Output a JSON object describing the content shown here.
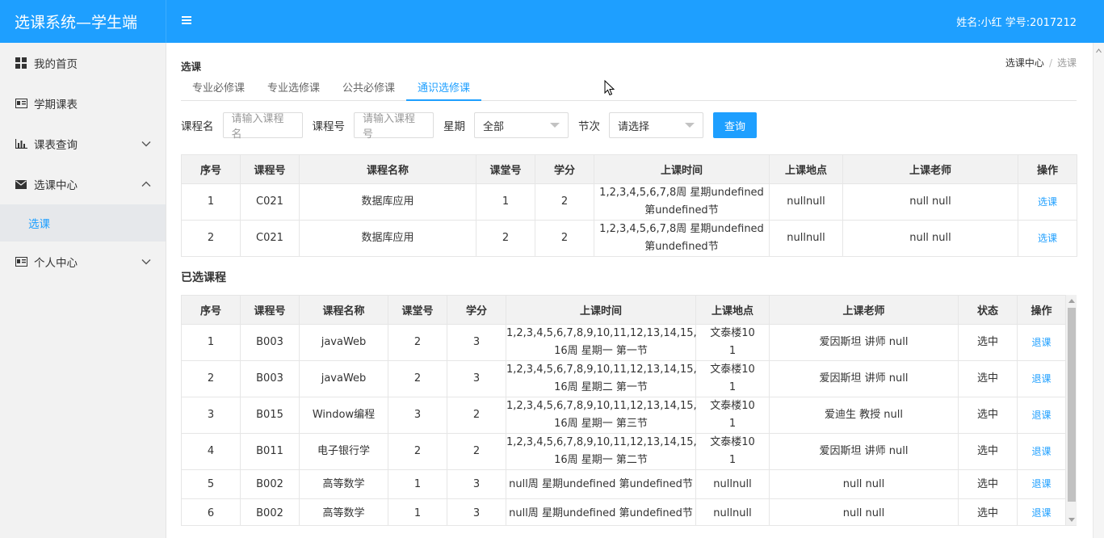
{
  "header": {
    "title": "选课系统—学生端",
    "user_info": "姓名:小红 学号:2017212"
  },
  "sidebar": {
    "items": [
      {
        "label": "我的首页",
        "icon": "grid-icon"
      },
      {
        "label": "学期课表",
        "icon": "id-card-icon"
      },
      {
        "label": "课表查询",
        "icon": "bar-chart-icon",
        "expandable": true
      },
      {
        "label": "选课中心",
        "icon": "envelope-icon",
        "expanded": true
      },
      {
        "label": "个人中心",
        "icon": "id-card-icon",
        "expandable": true
      }
    ],
    "sub_item": "选课"
  },
  "page": {
    "title": "选课",
    "breadcrumb": [
      "选课中心",
      "/",
      "选课"
    ]
  },
  "tabs": [
    {
      "label": "专业必修课",
      "active": false
    },
    {
      "label": "专业选修课",
      "active": false
    },
    {
      "label": "公共必修课",
      "active": false
    },
    {
      "label": "通识选修课",
      "active": true
    }
  ],
  "filters": {
    "course_name_label": "课程名",
    "course_name_placeholder": "请输入课程名",
    "course_no_label": "课程号",
    "course_no_placeholder": "请输入课程号",
    "weekday_label": "星期",
    "weekday_value": "全部",
    "period_label": "节次",
    "period_value": "请选择",
    "query_button": "查询"
  },
  "available_table": {
    "headers": [
      "序号",
      "课程号",
      "课程名称",
      "课堂号",
      "学分",
      "上课时间",
      "上课地点",
      "上课老师",
      "操作"
    ],
    "rows": [
      {
        "no": "1",
        "code": "C021",
        "name": "数据库应用",
        "class": "1",
        "credit": "2",
        "time1": "1,2,3,4,5,6,7,8周 星期undefined",
        "time2": "第undefined节",
        "place": "nullnull",
        "teacher": "null null",
        "action": "选课"
      },
      {
        "no": "2",
        "code": "C021",
        "name": "数据库应用",
        "class": "2",
        "credit": "2",
        "time1": "1,2,3,4,5,6,7,8周 星期undefined",
        "time2": "第undefined节",
        "place": "nullnull",
        "teacher": "null null",
        "action": "选课"
      }
    ]
  },
  "selected": {
    "title": "已选课程",
    "headers": [
      "序号",
      "课程号",
      "课程名称",
      "课堂号",
      "学分",
      "上课时间",
      "上课地点",
      "上课老师",
      "状态",
      "操作"
    ],
    "rows": [
      {
        "no": "1",
        "code": "B003",
        "name": "javaWeb",
        "class": "2",
        "credit": "3",
        "time1": "1,2,3,4,5,6,7,8,9,10,11,12,13,14,15,",
        "time2": "16周 星期一 第一节",
        "place1": "文泰楼10",
        "place2": "1",
        "teacher": "爱因斯坦 讲师 null",
        "status": "选中",
        "action": "退课"
      },
      {
        "no": "2",
        "code": "B003",
        "name": "javaWeb",
        "class": "2",
        "credit": "3",
        "time1": "1,2,3,4,5,6,7,8,9,10,11,12,13,14,15,",
        "time2": "16周 星期二 第一节",
        "place1": "文泰楼10",
        "place2": "1",
        "teacher": "爱因斯坦 讲师 null",
        "status": "选中",
        "action": "退课"
      },
      {
        "no": "3",
        "code": "B015",
        "name": "Window编程",
        "class": "3",
        "credit": "2",
        "time1": "1,2,3,4,5,6,7,8,9,10,11,12,13,14,15,",
        "time2": "16周 星期一 第三节",
        "place1": "文泰楼10",
        "place2": "1",
        "teacher": "爱迪生 教授 null",
        "status": "选中",
        "action": "退课"
      },
      {
        "no": "4",
        "code": "B011",
        "name": "电子银行学",
        "class": "2",
        "credit": "2",
        "time1": "1,2,3,4,5,6,7,8,9,10,11,12,13,14,15,",
        "time2": "16周 星期一 第二节",
        "place1": "文泰楼10",
        "place2": "1",
        "teacher": "爱因斯坦 讲师 null",
        "status": "选中",
        "action": "退课"
      },
      {
        "no": "5",
        "code": "B002",
        "name": "高等数学",
        "class": "1",
        "credit": "3",
        "time1": "null周 星期undefined 第undefined节",
        "time2": "",
        "place1": "nullnull",
        "place2": "",
        "teacher": "null null",
        "status": "选中",
        "action": "退课"
      },
      {
        "no": "6",
        "code": "B002",
        "name": "高等数学",
        "class": "1",
        "credit": "3",
        "time1": "null周 星期undefined 第undefined节",
        "time2": "",
        "place1": "nullnull",
        "place2": "",
        "teacher": "null null",
        "status": "选中",
        "action": "退课"
      }
    ]
  },
  "colors": {
    "primary": "#1e9fff",
    "sidebar_bg": "#f2f2f2",
    "header_row_bg": "#f2f2f2"
  }
}
